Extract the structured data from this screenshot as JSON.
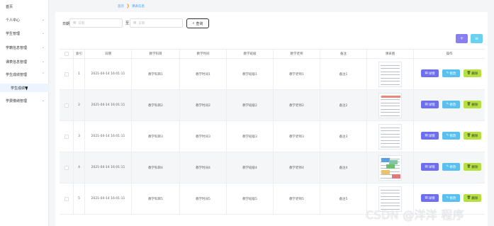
{
  "sidebar": {
    "items": [
      {
        "label": "首页",
        "has_chevron": false
      },
      {
        "label": "个人中心",
        "has_chevron": true
      },
      {
        "label": "学生管理",
        "has_chevron": true
      },
      {
        "label": "学籍信息管理",
        "has_chevron": true
      },
      {
        "label": "课表信息管理",
        "has_chevron": true
      },
      {
        "label": "学生成绩管理",
        "has_chevron": true
      },
      {
        "label": "学生成绩",
        "has_chevron": false
      },
      {
        "label": "学费缴纳管理",
        "has_chevron": true
      }
    ]
  },
  "breadcrumb": {
    "home": "首页",
    "current": "课表信息"
  },
  "search": {
    "date_label": "日期",
    "start_placeholder": "日期",
    "separator": "至",
    "end_placeholder": "日期",
    "query_label": "查询"
  },
  "toolbar": {
    "add_icon": "plus-icon",
    "delete_icon": "trash-icon"
  },
  "table": {
    "headers": [
      "",
      "索引",
      "日期",
      "教学科目",
      "教学时间",
      "教学班级",
      "教学老师",
      "备注",
      "课表图",
      "操作"
    ],
    "rows": [
      {
        "index": "1",
        "date": "2021-04-14 16:01:11",
        "subject": "教学科目1",
        "time": "教学时间1",
        "class": "教学班级1",
        "teacher": "教学老师1",
        "note": "备注1"
      },
      {
        "index": "2",
        "date": "2021-04-14 16:01:11",
        "subject": "教学科目2",
        "time": "教学时间2",
        "class": "教学班级2",
        "teacher": "教学老师2",
        "note": "备注2"
      },
      {
        "index": "3",
        "date": "2021-04-14 16:01:11",
        "subject": "教学科目3",
        "time": "教学时间3",
        "class": "教学班级3",
        "teacher": "教学老师3",
        "note": "备注3"
      },
      {
        "index": "4",
        "date": "2021-04-14 16:01:11",
        "subject": "教学科目4",
        "time": "教学时间4",
        "class": "教学班级4",
        "teacher": "教学老师4",
        "note": "备注4"
      },
      {
        "index": "5",
        "date": "2021-04-14 16:01:11",
        "subject": "教学科目5",
        "time": "教学时间5",
        "class": "教学班级5",
        "teacher": "教学老师5",
        "note": "备注5"
      }
    ],
    "actions": {
      "detail": "详情",
      "edit": "修改",
      "delete": "删除"
    }
  },
  "watermark": "CSDN @洋洋 程序",
  "colors": {
    "primary": "#409eff",
    "detail": "#6d6ff0",
    "edit": "#5bc0f0",
    "delete": "#b6e040",
    "add": "#8a7ff0",
    "remove": "#6ad0f0"
  }
}
